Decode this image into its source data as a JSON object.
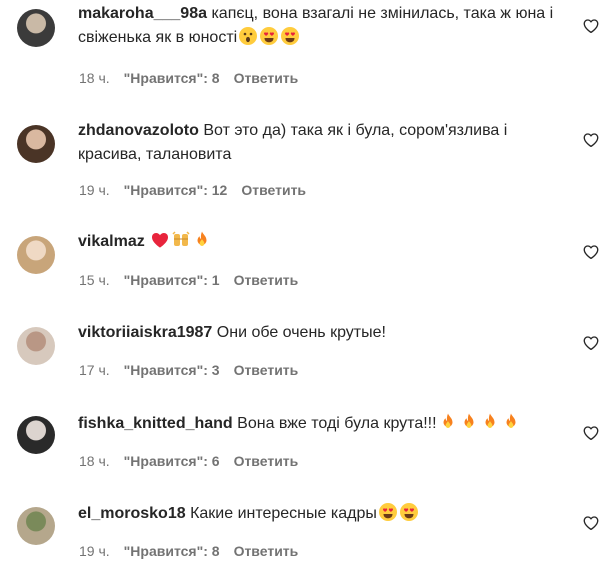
{
  "comments": [
    {
      "username": "makaroha___98a",
      "text": "капєц, вона взагалі не змінилась, така ж юна і свіженька як в юності",
      "emojis": [
        "astonished",
        "heart-eyes",
        "heart-eyes"
      ],
      "time": "18 ч.",
      "likes": "\"Нравится\": 8",
      "reply": "Ответить",
      "avatar_colors": [
        "#3b3b3b",
        "#c9b9a6"
      ]
    },
    {
      "username": "zhdanovazoloto",
      "text": "Вот это да) така як і була, сором'язлива і красива, талановита",
      "emojis": [],
      "time": "19 ч.",
      "likes": "\"Нравится\": 12",
      "reply": "Ответить",
      "avatar_colors": [
        "#4a3426",
        "#d9b8a0"
      ]
    },
    {
      "username": "vikalmaz",
      "text": "",
      "emojis": [
        "red-heart",
        "raising-hands",
        "fire"
      ],
      "time": "15 ч.",
      "likes": "\"Нравится\": 1",
      "reply": "Ответить",
      "avatar_colors": [
        "#c8a57a",
        "#efd9c4"
      ]
    },
    {
      "username": "viktoriiaiskra1987",
      "text": "Они обе очень крутые!",
      "emojis": [],
      "time": "17 ч.",
      "likes": "\"Нравится\": 3",
      "reply": "Ответить",
      "avatar_colors": [
        "#d7c9bd",
        "#b99785"
      ]
    },
    {
      "username": "fishka_knitted_hand",
      "text": "Вона вже тоді була крута!!!",
      "emojis": [
        "fire",
        "fire",
        "fire",
        "fire"
      ],
      "time": "18 ч.",
      "likes": "\"Нравится\": 6",
      "reply": "Ответить",
      "avatar_colors": [
        "#2a2a2a",
        "#dcd4cf"
      ]
    },
    {
      "username": "el_morosko18",
      "text": "Какие интересные кадры",
      "emojis": [
        "heart-eyes",
        "heart-eyes"
      ],
      "time": "19 ч.",
      "likes": "\"Нравится\": 8",
      "reply": "Ответить",
      "avatar_colors": [
        "#b5a78c",
        "#7a8a5a"
      ]
    }
  ]
}
